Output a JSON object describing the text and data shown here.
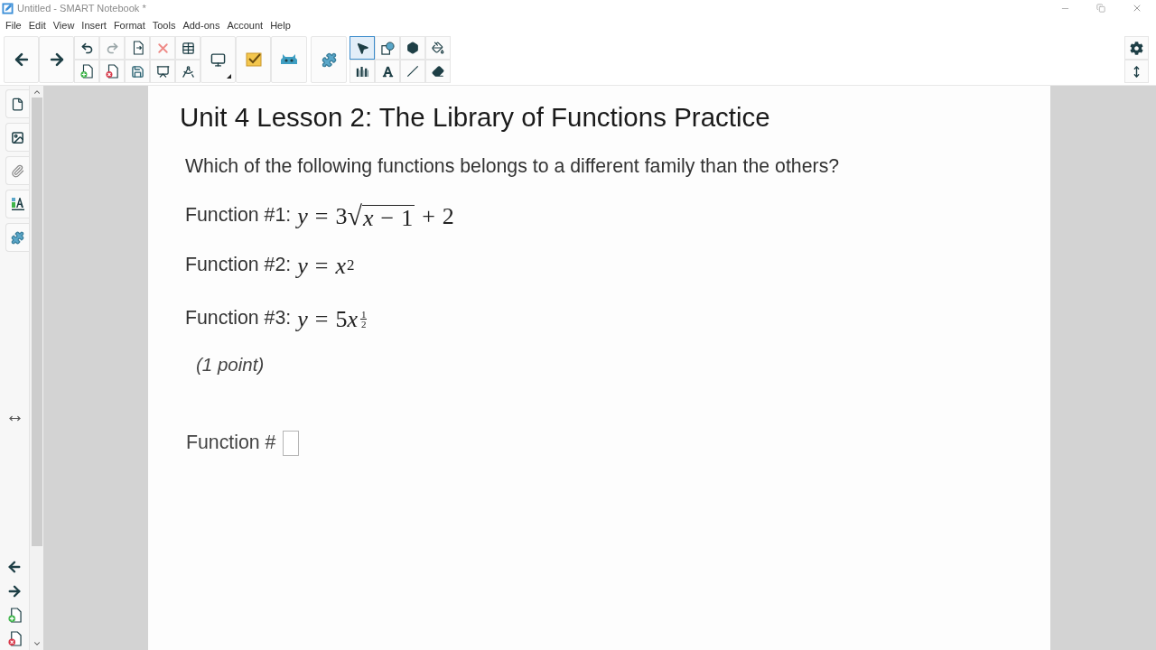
{
  "window": {
    "title": "Untitled - SMART Notebook *"
  },
  "menu": [
    "File",
    "Edit",
    "View",
    "Insert",
    "Format",
    "Tools",
    "Add-ons",
    "Account",
    "Help"
  ],
  "toolbar": {
    "tools": [
      {
        "kind": "select",
        "selected": true
      },
      {
        "kind": "shapes",
        "selected": false
      },
      {
        "kind": "polygon",
        "selected": false
      },
      {
        "kind": "fill",
        "selected": false
      },
      {
        "kind": "pens",
        "selected": false
      },
      {
        "kind": "text",
        "selected": false
      },
      {
        "kind": "lines",
        "selected": false
      },
      {
        "kind": "eraser",
        "selected": false
      }
    ]
  },
  "page": {
    "title": "Unit 4 Lesson 2: The Library of Functions Practice",
    "question": "Which of the following functions belongs to a different family than the others?",
    "functions": [
      {
        "label": "Function #1:",
        "equation": [
          {
            "kind": "var",
            "text": "y"
          },
          {
            "kind": "op",
            "text": "="
          },
          {
            "kind": "num",
            "text": "3"
          },
          {
            "kind": "sqrt",
            "sign": "√",
            "body": [
              {
                "kind": "var",
                "text": "x"
              },
              {
                "kind": "op",
                "text": "−"
              },
              {
                "kind": "num",
                "text": "1"
              }
            ]
          },
          {
            "kind": "op",
            "text": "+"
          },
          {
            "kind": "num",
            "text": "2"
          }
        ]
      },
      {
        "label": "Function #2:",
        "equation": [
          {
            "kind": "var",
            "text": "y"
          },
          {
            "kind": "op",
            "text": "="
          },
          {
            "kind": "var",
            "text": "x"
          },
          {
            "kind": "sup",
            "body": [
              {
                "kind": "num",
                "text": "2"
              }
            ]
          }
        ]
      },
      {
        "label": "Function #3:",
        "equation": [
          {
            "kind": "var",
            "text": "y"
          },
          {
            "kind": "op",
            "text": "="
          },
          {
            "kind": "num",
            "text": "5"
          },
          {
            "kind": "var",
            "text": "x"
          },
          {
            "kind": "frac_sup",
            "numerator": "1",
            "denominator": "2"
          }
        ]
      }
    ],
    "points": "(1 point)",
    "answer": {
      "label": "Function #"
    }
  }
}
